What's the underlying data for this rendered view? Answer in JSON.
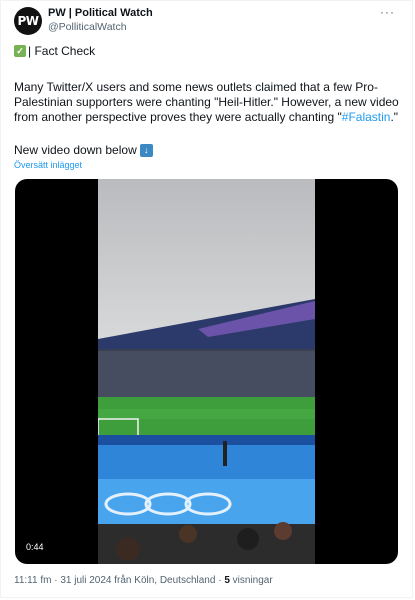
{
  "author": {
    "avatar_text": "PW",
    "name": "PW | Political Watch",
    "handle": "@PolliticalWatch"
  },
  "more_label": "···",
  "post": {
    "fact_check": "| Fact Check",
    "body_before": "Many Twitter/X users and some news outlets claimed that a few Pro-Palestinian supporters were chanting \"Heil-Hitler.\" However, a new video from another perspective proves they were actually chanting \"",
    "hashtag": "#Falastin",
    "body_after": ".\"",
    "new_video": "New video down below",
    "translate_link": "Översätt inlägget"
  },
  "video": {
    "timecode": "0:44"
  },
  "meta": {
    "time": "11:11 fm",
    "date_place": "31 juli 2024 från Köln, Deutschland",
    "views_count": "5",
    "views_label": "visningar"
  },
  "colors": {
    "accent": "#1d9bf0",
    "check": "#77b255",
    "down_arrow": "#3b88c3"
  }
}
